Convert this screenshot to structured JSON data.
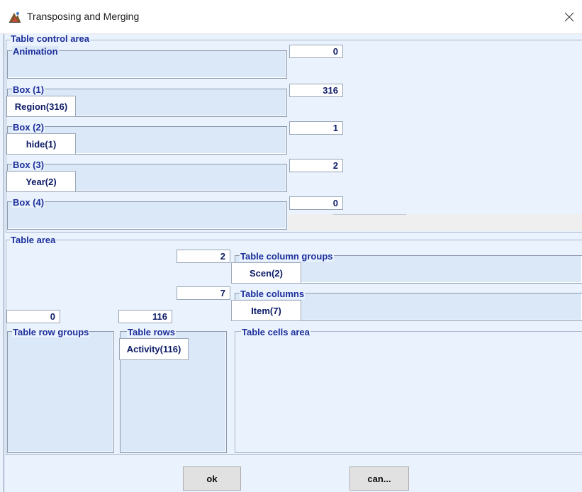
{
  "window": {
    "title": "Transposing and Merging"
  },
  "table_control_area": {
    "label": "Table control area",
    "animation": {
      "label": "Animation",
      "value": "0"
    },
    "box1": {
      "label": "Box (1)",
      "value": "316",
      "chip": "Region(316)"
    },
    "box2": {
      "label": "Box (2)",
      "value": "1",
      "chip": "hide(1)"
    },
    "box3": {
      "label": "Box (3)",
      "value": "2",
      "chip": "Year(2)"
    },
    "box4": {
      "label": "Box (4)",
      "value": "0"
    }
  },
  "table_area": {
    "label": "Table area",
    "column_groups": {
      "label": "Table column groups",
      "value": "2",
      "chip": "Scen(2)"
    },
    "columns": {
      "label": "Table columns",
      "value": "7",
      "chip": "Item(7)"
    },
    "row_groups": {
      "label": "Table row groups",
      "value": "0"
    },
    "rows": {
      "label": "Table rows",
      "value": "116",
      "chip": "Activity(116)"
    },
    "cells": {
      "label": "Table cells area"
    }
  },
  "buttons": {
    "ok": "ok",
    "cancel": "can..."
  }
}
